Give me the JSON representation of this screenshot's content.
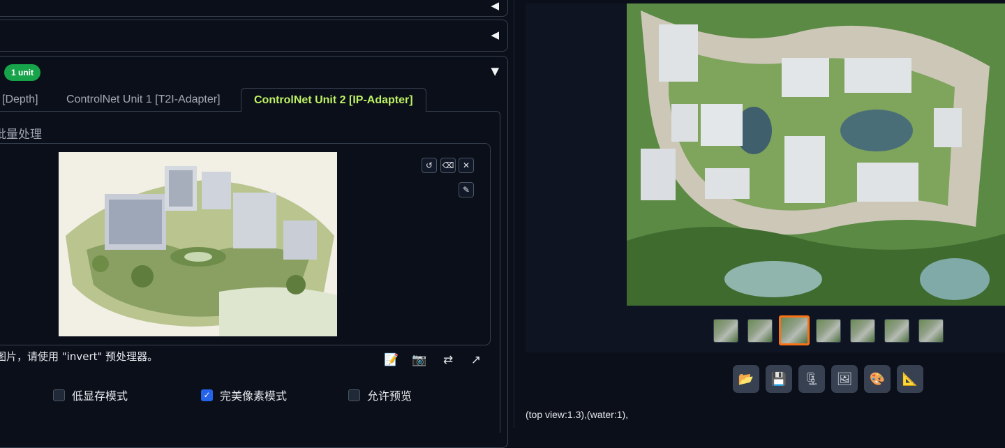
{
  "accordion": {
    "collapsed_icon": "◀",
    "expanded_icon": "▼",
    "unit_badge": "1 unit"
  },
  "tabs": [
    {
      "label": "[Depth]"
    },
    {
      "label": "ControlNet Unit 1 [T2I-Adapter]"
    },
    {
      "label": "ControlNet Unit 2 [IP-Adapter]"
    }
  ],
  "section": {
    "title": "批量处理"
  },
  "image_tools": {
    "undo_icon": "↺",
    "erase_icon": "⌫",
    "close_icon": "✕",
    "brush_icon": "✎"
  },
  "hint": "图片，请使用 \"invert\" 预处理器。",
  "toolbar": {
    "edit_icon": "📝",
    "camera_icon": "📷",
    "swap_icon": "⇄",
    "send_icon": "↗"
  },
  "options": [
    {
      "label": "低显存模式",
      "checked": false
    },
    {
      "label": "完美像素模式",
      "checked": true
    },
    {
      "label": "允许预览",
      "checked": false
    }
  ],
  "gallery": {
    "thumbnail_count": 7,
    "selected_index": 2
  },
  "actions": [
    {
      "name": "folder-icon",
      "glyph": "📂"
    },
    {
      "name": "save-icon",
      "glyph": "💾"
    },
    {
      "name": "archive-icon",
      "glyph": "🗜"
    },
    {
      "name": "image-icon",
      "glyph": "🖼"
    },
    {
      "name": "palette-icon",
      "glyph": "🎨"
    },
    {
      "name": "ruler-icon",
      "glyph": "📐"
    }
  ],
  "prompt": "(top view:1.3),(water:1),",
  "colors": {
    "accent_tab": "#bef264",
    "badge": "#16a34a",
    "selected_thumb": "#f97316",
    "checkbox": "#2563eb"
  }
}
